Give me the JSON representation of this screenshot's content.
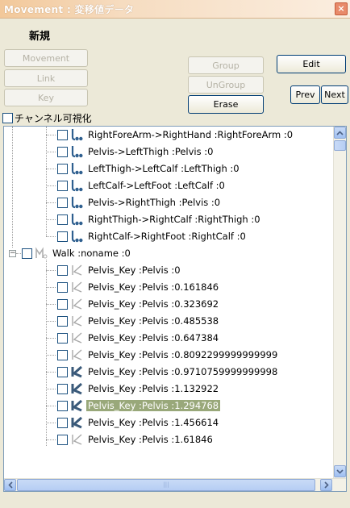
{
  "window": {
    "title": "Movement : 変移値データ",
    "close_glyph": "×"
  },
  "toolbar": {
    "section_label": "新規",
    "movement_label": "Movement",
    "link_label": "Link",
    "key_label": "Key",
    "group_label": "Group",
    "ungroup_label": "UnGroup",
    "erase_label": "Erase",
    "edit_label": "Edit",
    "prev_label": "Prev",
    "next_label": "Next"
  },
  "visualize": {
    "label": "チャンネル可視化",
    "checked": false
  },
  "tree": {
    "links": [
      "RightForeArm->RightHand :RightForeArm :0",
      "Pelvis->LeftThigh :Pelvis :0",
      "LeftThigh->LeftCalf :LeftThigh :0",
      "LeftCalf->LeftFoot :LeftCalf :0",
      "Pelvis->RightThigh :Pelvis :0",
      "RightThigh->RightCalf :RightThigh :0",
      "RightCalf->RightFoot :RightCalf :0"
    ],
    "movement": "Walk :noname :0",
    "keys": [
      {
        "text": "Pelvis_Key :Pelvis :0",
        "style": "light"
      },
      {
        "text": "Pelvis_Key :Pelvis :0.161846",
        "style": "light"
      },
      {
        "text": "Pelvis_Key :Pelvis :0.323692",
        "style": "light"
      },
      {
        "text": "Pelvis_Key :Pelvis :0.485538",
        "style": "light"
      },
      {
        "text": "Pelvis_Key :Pelvis :0.647384",
        "style": "light"
      },
      {
        "text": "Pelvis_Key :Pelvis :0.8092299999999999",
        "style": "light"
      },
      {
        "text": "Pelvis_Key :Pelvis :0.9710759999999998",
        "style": "dark"
      },
      {
        "text": "Pelvis_Key :Pelvis :1.132922",
        "style": "dark"
      },
      {
        "text": "Pelvis_Key :Pelvis :1.294768",
        "style": "dark"
      },
      {
        "text": "Pelvis_Key :Pelvis :1.456614",
        "style": "dark"
      },
      {
        "text": "Pelvis_Key :Pelvis :1.61846",
        "style": "light"
      }
    ],
    "selected_key_index": 8
  },
  "scrollbar": {
    "grip": "|||"
  },
  "colors": {
    "selection": "#99a87a",
    "link_icon": "#2e5f8f",
    "key_icon_dark": "#3a5a7a",
    "key_icon_light": "#a8a8a8"
  }
}
